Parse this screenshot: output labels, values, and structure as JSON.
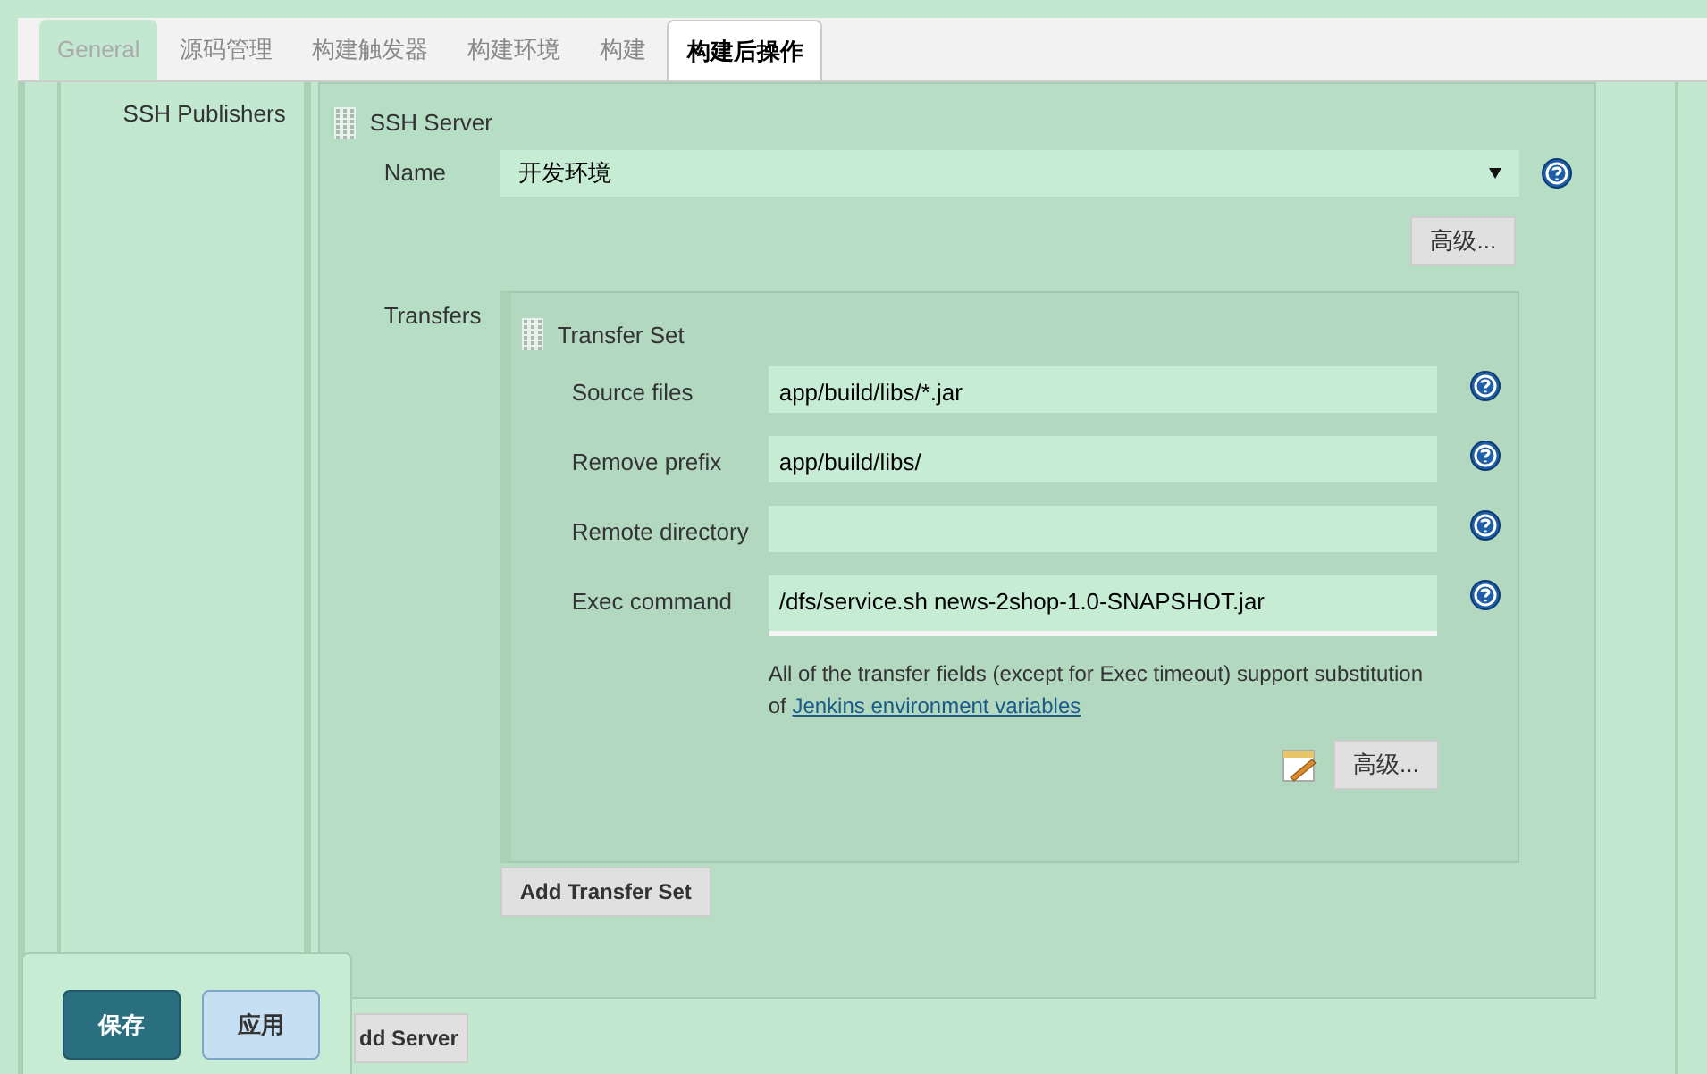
{
  "tabs": [
    {
      "label": "General",
      "selected": false,
      "disabled": true
    },
    {
      "label": "源码管理",
      "selected": false,
      "disabled": false
    },
    {
      "label": "构建触发器",
      "selected": false,
      "disabled": false
    },
    {
      "label": "构建环境",
      "selected": false,
      "disabled": false
    },
    {
      "label": "构建",
      "selected": false,
      "disabled": false
    },
    {
      "label": "构建后操作",
      "selected": true,
      "disabled": false
    }
  ],
  "section_label": "SSH Publishers",
  "server": {
    "title": "SSH Server",
    "name_label": "Name",
    "name_value": "开发环境",
    "advanced_button": "高级...",
    "transfers_label": "Transfers",
    "transfer_set": {
      "title": "Transfer Set",
      "fields": [
        {
          "label": "Source files",
          "value": "app/build/libs/*.jar",
          "kind": "input"
        },
        {
          "label": "Remove prefix",
          "value": "app/build/libs/",
          "kind": "input"
        },
        {
          "label": "Remote directory",
          "kind": "input"
        },
        {
          "label": "Exec command",
          "value": "/dfs/service.sh news-2shop-1.0-SNAPSHOT.jar",
          "kind": "textarea"
        }
      ],
      "note": "All of the transfer fields (except for Exec timeout) support substitution of",
      "note_link": "Jenkins environment variables",
      "advanced_button": "高级..."
    },
    "add_transfer_button": "Add Transfer Set"
  },
  "add_server_button": "dd Server",
  "bottom_buttons": [
    {
      "label": "保存",
      "kind": "primary"
    },
    {
      "label": "应用",
      "kind": "secondary"
    }
  ]
}
